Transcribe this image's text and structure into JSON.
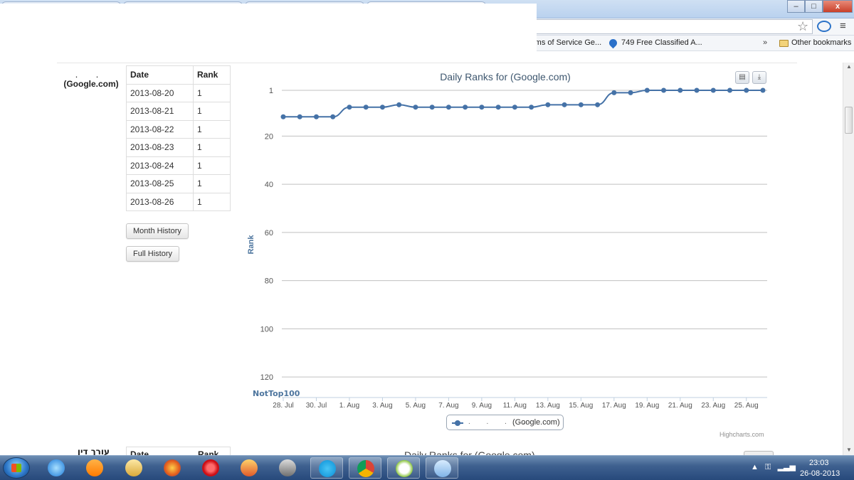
{
  "browser": {
    "bookmarks": [
      {
        "label": "rms of Service Ge..."
      },
      {
        "label": "749 Free Classified A..."
      }
    ],
    "bookmarks_more": "»",
    "other_bookmarks": "Other bookmarks",
    "window_buttons": {
      "minimize": "–",
      "maximize": "□",
      "close": "x"
    }
  },
  "site": {
    "label_dots": ". .",
    "label": "(Google.com)"
  },
  "table": {
    "headers": {
      "date": "Date",
      "rank": "Rank"
    },
    "rows": [
      {
        "date": "2013-08-20",
        "rank": "1"
      },
      {
        "date": "2013-08-21",
        "rank": "1"
      },
      {
        "date": "2013-08-22",
        "rank": "1"
      },
      {
        "date": "2013-08-23",
        "rank": "1"
      },
      {
        "date": "2013-08-24",
        "rank": "1"
      },
      {
        "date": "2013-08-25",
        "rank": "1"
      },
      {
        "date": "2013-08-26",
        "rank": "1"
      }
    ]
  },
  "buttons": {
    "month_history": "Month History",
    "full_history": "Full History"
  },
  "chart_icons": {
    "print": "print-icon",
    "export": "download-icon"
  },
  "chart_data": {
    "type": "line",
    "title": "Daily Ranks for",
    "title_suffix": "(Google.com)",
    "ylabel": "Rank",
    "y_reversed": true,
    "ylim": [
      1,
      125
    ],
    "y_ticks": [
      1,
      20,
      40,
      60,
      80,
      100,
      120
    ],
    "y_bottom_label": "NotTop100",
    "x_ticks": [
      "28. Jul",
      "30. Jul",
      "1. Aug",
      "3. Aug",
      "5. Aug",
      "7. Aug",
      "9. Aug",
      "11. Aug",
      "13. Aug",
      "15. Aug",
      "17. Aug",
      "19. Aug",
      "21. Aug",
      "23. Aug",
      "25. Aug"
    ],
    "x": [
      "2013-07-28",
      "2013-07-29",
      "2013-07-30",
      "2013-07-31",
      "2013-08-01",
      "2013-08-02",
      "2013-08-03",
      "2013-08-04",
      "2013-08-05",
      "2013-08-06",
      "2013-08-07",
      "2013-08-08",
      "2013-08-09",
      "2013-08-10",
      "2013-08-11",
      "2013-08-12",
      "2013-08-13",
      "2013-08-14",
      "2013-08-15",
      "2013-08-16",
      "2013-08-17",
      "2013-08-18",
      "2013-08-19",
      "2013-08-20",
      "2013-08-21",
      "2013-08-22",
      "2013-08-23",
      "2013-08-24",
      "2013-08-25",
      "2013-08-26"
    ],
    "series": [
      {
        "name": "(Google.com)",
        "color": "#4572a7",
        "values": [
          12,
          12,
          12,
          12,
          8,
          8,
          8,
          7,
          8,
          8,
          8,
          8,
          8,
          8,
          8,
          8,
          7,
          7,
          7,
          7,
          2,
          2,
          1,
          1,
          1,
          1,
          1,
          1,
          1,
          1
        ]
      }
    ],
    "grid": true,
    "legend": "bottom-center",
    "legend_dots": ". . . .",
    "credits": "Highcharts.com"
  },
  "second_section": {
    "label": "עורך דין פלילי",
    "headers": {
      "date": "Date",
      "rank": "Rank"
    },
    "title": "Daily Ranks for        (Google.com)"
  },
  "taskbar": {
    "apps": [
      "internet-explorer-icon",
      "vlc-icon",
      "file-explorer-icon",
      "firefox-icon",
      "opera-icon",
      "photo-gallery-icon",
      "network-icon",
      "skype-icon",
      "chrome-icon",
      "google-talk-icon",
      "paint-icon"
    ],
    "time": "23:03",
    "date": "26-08-2013"
  }
}
